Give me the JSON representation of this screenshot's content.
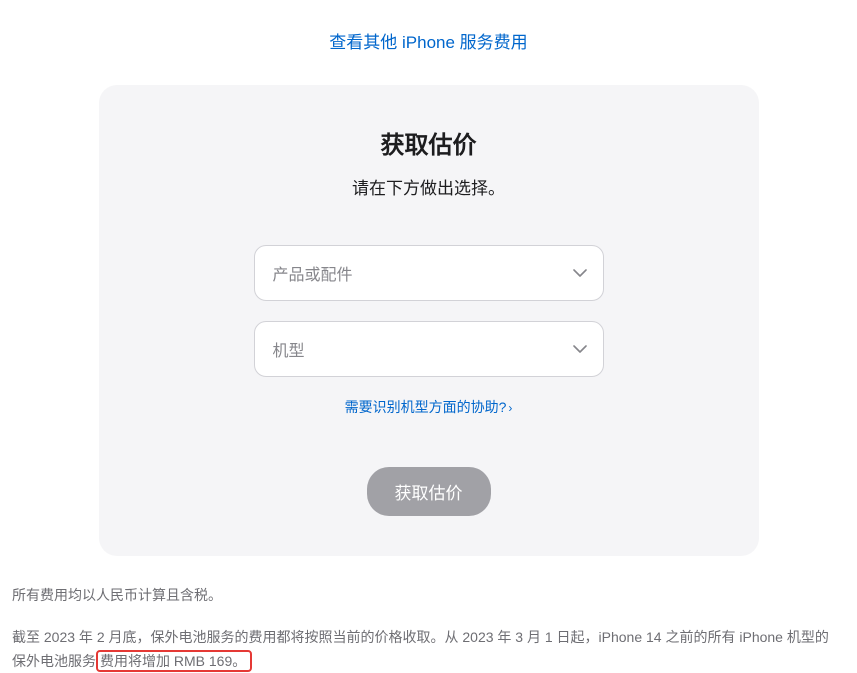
{
  "topLink": {
    "label": "查看其他 iPhone 服务费用"
  },
  "card": {
    "title": "获取估价",
    "subtitle": "请在下方做出选择。",
    "select1": {
      "placeholder": "产品或配件"
    },
    "select2": {
      "placeholder": "机型"
    },
    "helpLink": {
      "label": "需要识别机型方面的协助?"
    },
    "submit": {
      "label": "获取估价"
    }
  },
  "footer": {
    "line1": "所有费用均以人民币计算且含税。",
    "line2_part1": "截至 2023 年 2 月底，保外电池服务的费用都将按照当前的价格收取。从 2023 年 3 月 1 日起，iPhone 14 之前的所有 iPhone 机型的保外电池服务",
    "line2_highlight": "费用将增加 RMB 169。"
  }
}
